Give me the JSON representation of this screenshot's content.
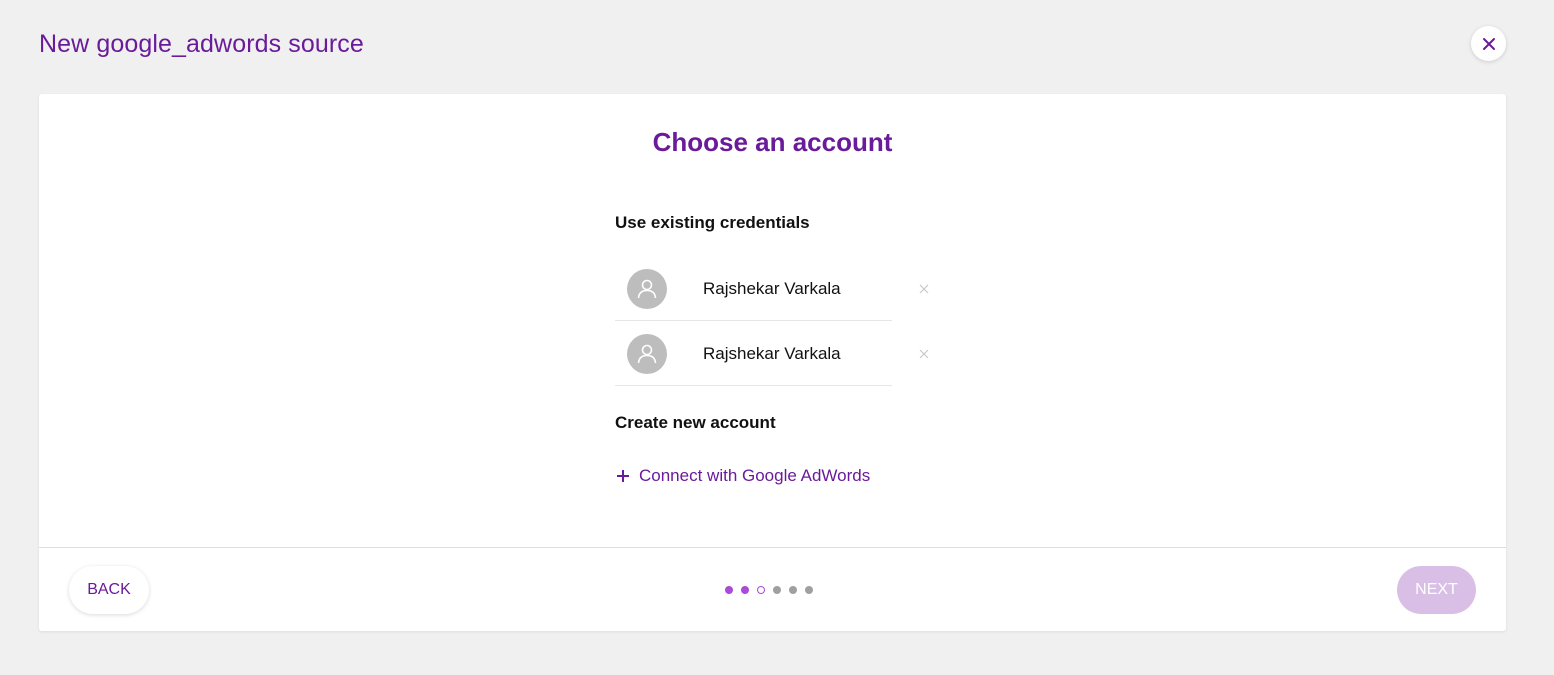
{
  "page": {
    "title": "New google_adwords source",
    "close_icon": "close-icon"
  },
  "card": {
    "heading": "Choose an account",
    "existing_label": "Use existing credentials",
    "credentials": [
      {
        "name": "Rajshekar Varkala",
        "avatar_icon": "user-icon",
        "remove_icon": "close-icon"
      },
      {
        "name": "Rajshekar Varkala",
        "avatar_icon": "user-icon",
        "remove_icon": "close-icon"
      }
    ],
    "create_label": "Create new account",
    "connect_label": "Connect with Google AdWords"
  },
  "footer": {
    "back_label": "BACK",
    "next_label": "NEXT",
    "steps": [
      "done",
      "done",
      "current",
      "todo",
      "todo",
      "todo"
    ]
  },
  "colors": {
    "accent": "#6a1b9a",
    "step_active": "#a84bd6",
    "next_disabled": "#d9bfe6",
    "background": "#f0f0f0"
  }
}
